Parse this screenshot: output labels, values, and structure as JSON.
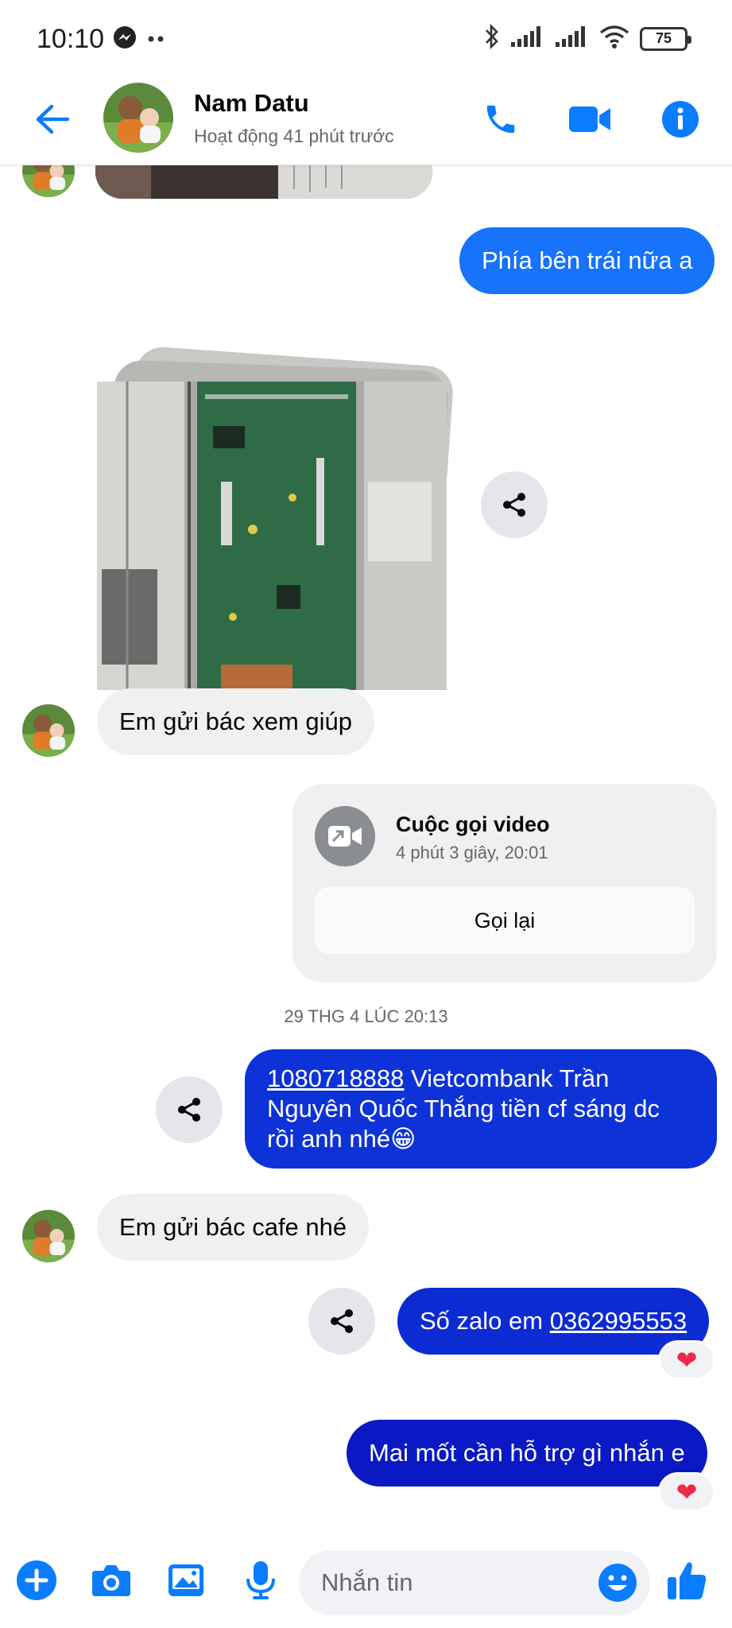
{
  "colors": {
    "accent": "#0a7cff",
    "bubble_gradient_top": "#1a6aff",
    "bubble_gradient_bottom": "#0b15c5",
    "incoming_bubble": "#f0f0f0",
    "heart": "#f02849"
  },
  "status_bar": {
    "time": "10:10",
    "left_icons": [
      "messenger-icon",
      "more-dots-icon"
    ],
    "right_icons": [
      "bluetooth-icon",
      "signal-icon",
      "signal-icon",
      "wifi-icon"
    ],
    "battery": "75"
  },
  "header": {
    "contact_name": "Nam Datu",
    "status": "Hoạt động 41 phút trước",
    "actions": [
      "phone-icon",
      "video-camera-icon",
      "info-icon"
    ]
  },
  "messages": {
    "m1": {
      "text": "Phía bên trái nữa a"
    },
    "m2": {
      "text": "Em gửi bác xem giúp"
    },
    "call": {
      "title": "Cuộc gọi video",
      "detail": "4 phút 3 giây, 20:01",
      "button": "Gọi lại"
    },
    "timestamp": "29 THG 4 LÚC 20:13",
    "m3": {
      "link": "1080718888",
      "line1_rest": " Vietcombank Trần",
      "line2": "Nguyên Quốc Thắng tiền cf sáng dc",
      "line3": "rồi anh nhé😁"
    },
    "m4": {
      "text": "Em gửi bác cafe nhé"
    },
    "m5": {
      "prefix": "Số zalo em ",
      "link": "0362995553",
      "reaction": "❤"
    },
    "m6": {
      "text": "Mai mốt cần hỗ trợ gì nhắn e",
      "reaction": "❤"
    }
  },
  "composer": {
    "placeholder": "Nhắn tin",
    "icons": [
      "plus-icon",
      "camera-icon",
      "gallery-icon",
      "microphone-icon",
      "emoji-icon",
      "thumbs-up-icon"
    ]
  }
}
